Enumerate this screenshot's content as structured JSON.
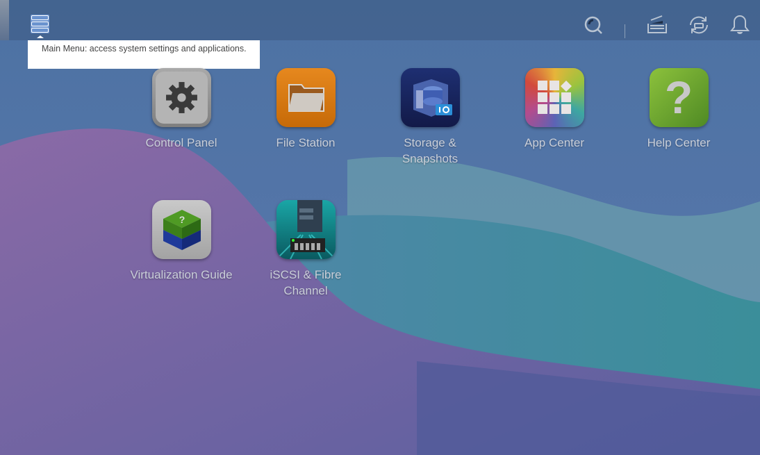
{
  "topbar": {
    "main_menu_tooltip": "Main Menu: access system settings and applications.",
    "icons": [
      "search-icon",
      "background-tasks-icon",
      "external-device-sync-icon",
      "notification-bell-icon"
    ]
  },
  "apps": [
    {
      "label": "Control Panel",
      "icon": "gear-icon",
      "color": "#8e8e8e"
    },
    {
      "label": "File Station",
      "icon": "folder-icon",
      "color": "#d9770f"
    },
    {
      "label": "Storage & Snapshots",
      "icon": "storage-icon",
      "color": "#1d2d6a"
    },
    {
      "label": "App Center",
      "icon": "app-grid-icon",
      "color": "#c8584e"
    },
    {
      "label": "Help Center",
      "icon": "question-icon",
      "color": "#6ea02c"
    },
    {
      "label": "Virtualization Guide",
      "icon": "virtualization-cube-icon",
      "color": "#b5b5b5"
    },
    {
      "label": "iSCSI & Fibre Channel",
      "icon": "iscsi-server-icon",
      "color": "#0f8a8a"
    }
  ]
}
